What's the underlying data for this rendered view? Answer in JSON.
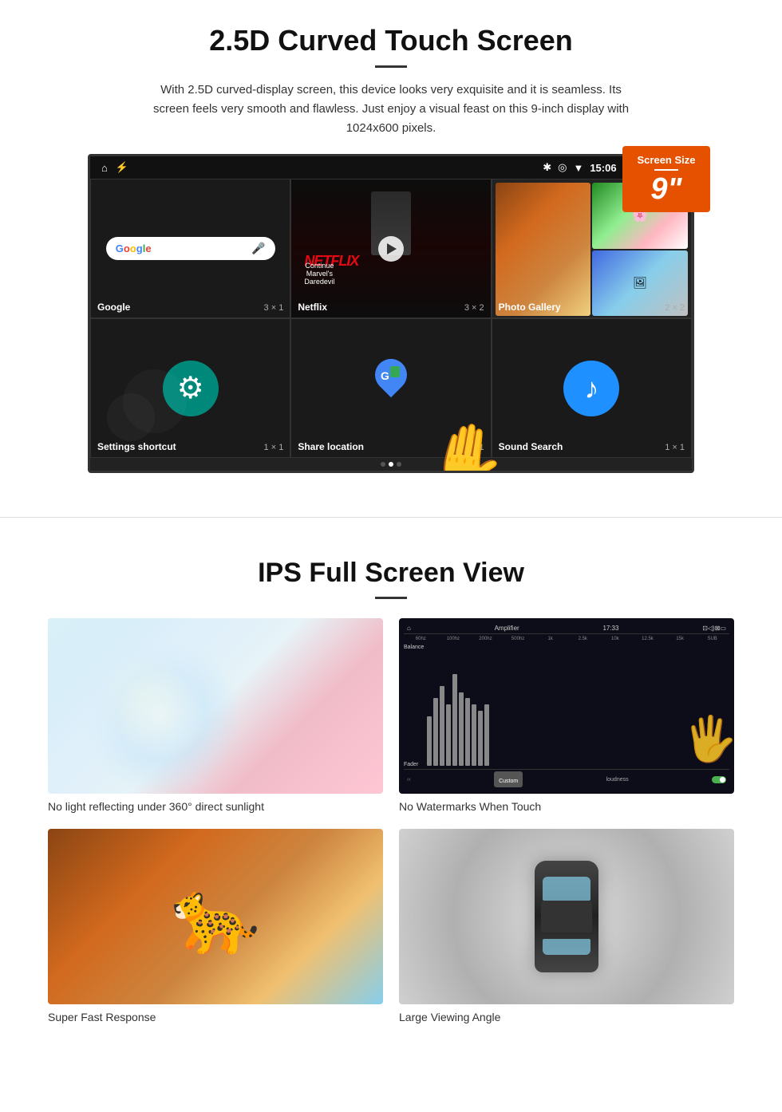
{
  "section1": {
    "title": "2.5D Curved Touch Screen",
    "description": "With 2.5D curved-display screen, this device looks very exquisite and it is seamless. Its screen feels very smooth and flawless. Just enjoy a visual feast on this 9-inch display with 1024x600 pixels.",
    "screen_badge": {
      "label": "Screen Size",
      "size": "9\""
    },
    "status_bar": {
      "time": "15:06"
    },
    "app_cells": [
      {
        "name": "Google",
        "grid": "3 × 1"
      },
      {
        "name": "Netflix",
        "grid": "3 × 2"
      },
      {
        "name": "Photo Gallery",
        "grid": "2 × 2"
      },
      {
        "name": "Settings shortcut",
        "grid": "1 × 1"
      },
      {
        "name": "Share location",
        "grid": "1 × 1"
      },
      {
        "name": "Sound Search",
        "grid": "1 × 1"
      }
    ],
    "netflix": {
      "logo": "NETFLIX",
      "subtitle": "Continue Marvel's Daredevil"
    }
  },
  "section2": {
    "title": "IPS Full Screen View",
    "features": [
      {
        "caption": "No light reflecting under 360° direct sunlight",
        "img_type": "sky"
      },
      {
        "caption": "No Watermarks When Touch",
        "img_type": "equalizer"
      },
      {
        "caption": "Super Fast Response",
        "img_type": "cheetah"
      },
      {
        "caption": "Large Viewing Angle",
        "img_type": "car"
      }
    ],
    "eq_labels": [
      "60hz",
      "100hz",
      "200hz",
      "500hz",
      "1k",
      "2.5k",
      "10k",
      "12.5k",
      "15k",
      "SUB"
    ],
    "eq_heights": [
      40,
      55,
      65,
      50,
      45,
      70,
      60,
      55,
      50,
      45
    ],
    "eq_bottom_left": "Custom",
    "eq_bottom_right": "loudness"
  }
}
